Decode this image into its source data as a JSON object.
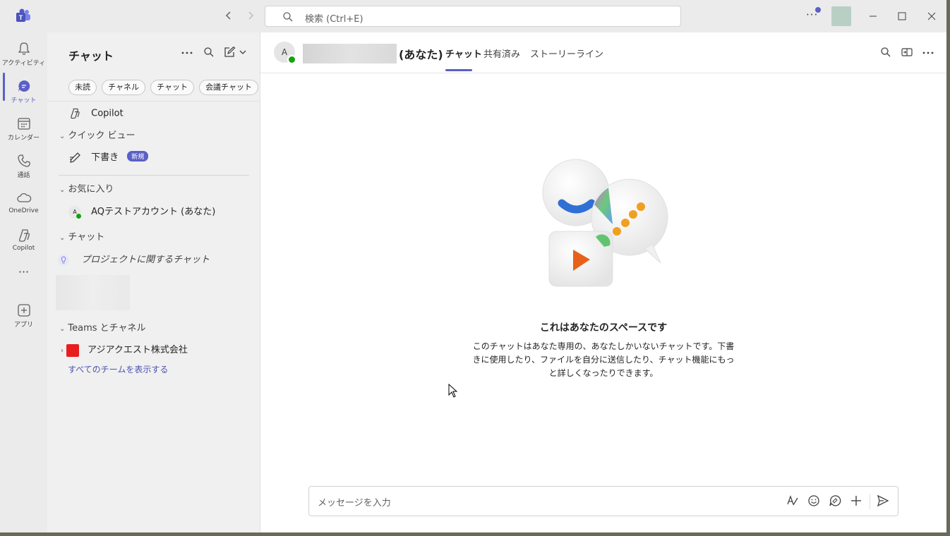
{
  "titlebar": {
    "search_placeholder": "検索 (Ctrl+E)",
    "back_icon": "chevron-left-icon",
    "forward_icon": "chevron-right-icon",
    "more_label": "···"
  },
  "rail": {
    "items": [
      {
        "label": "アクティビティ",
        "icon": "bell-icon"
      },
      {
        "label": "チャット",
        "icon": "chat-icon",
        "active": true
      },
      {
        "label": "カレンダー",
        "icon": "calendar-icon"
      },
      {
        "label": "通話",
        "icon": "phone-icon"
      },
      {
        "label": "OneDrive",
        "icon": "cloud-icon"
      },
      {
        "label": "Copilot",
        "icon": "copilot-icon"
      },
      {
        "label": "···",
        "icon": "more-icon"
      },
      {
        "label": "アプリ",
        "icon": "add-app-icon"
      }
    ]
  },
  "chatlist": {
    "title": "チャット",
    "filters": [
      "未読",
      "チャネル",
      "チャット",
      "会議チャット"
    ],
    "copilot": "Copilot",
    "quick_view": "クイック ビュー",
    "draft": "下書き",
    "draft_badge": "新規",
    "favorites": "お気に入り",
    "favorite_item": "AQテストアカウント (あなた)",
    "favorite_avatar": "A",
    "chats_section": "チャット",
    "project_chat": "プロジェクトに関するチャット",
    "teams_section": "Teams とチャネル",
    "team_name": "アジアクエスト株式会社",
    "show_all_teams": "すべてのチームを表示する"
  },
  "header": {
    "avatar_initial": "A",
    "you_suffix": "(あなた)",
    "tabs": [
      "チャット",
      "共有済み",
      "ストーリーライン"
    ]
  },
  "empty_state": {
    "title": "これはあなたのスペースです",
    "description": "このチャットはあなた専用の、あなたしかいないチャットです。下書きに使用したり、ファイルを自分に送信したり、チャット機能にもっと詳しくなったりできます。"
  },
  "compose": {
    "placeholder": "メッセージを入力"
  },
  "colors": {
    "accent": "#5b5fc7",
    "presence": "#13a10e",
    "team_logo": "#e81e1e"
  }
}
